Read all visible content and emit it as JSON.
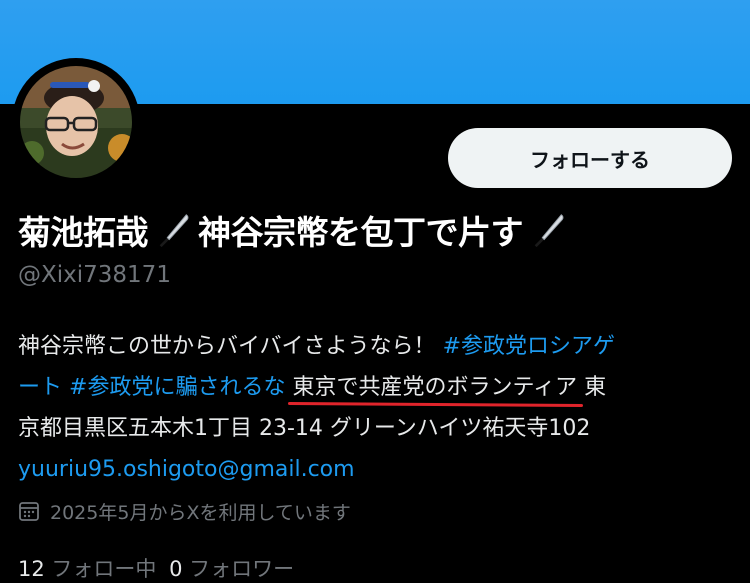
{
  "profile": {
    "name": "菊池拓哉",
    "name_middle": "神谷宗幣を包丁で片す",
    "knife_icon": "kitchen-knife-emoji",
    "handle": "@Xixi738171",
    "follow_label": "フォローする"
  },
  "bio": {
    "line1_text": "神谷宗幣この世からバイバイさようなら！",
    "hashtag1_part1": "#参政党ロシアゲ",
    "hashtag1_part2": "ート",
    "hashtag2": "#参政党に騙されるな",
    "underlined_text": "東京で共産党のボランティア",
    "line2_tail": "東",
    "line3_text": "京都目黒区五本木1丁目 23-14 グリーンハイツ祐天寺102",
    "email": "yuuriu95.oshigoto@gmail.com"
  },
  "joined": {
    "icon": "calendar-icon",
    "text": "2025年5月からXを利用しています"
  },
  "counts": {
    "following_count": "12",
    "following_label": "フォロー中",
    "followers_count": "0",
    "followers_label": "フォロワー"
  },
  "colors": {
    "banner": "#1d9bf0",
    "link": "#1d9bf0",
    "annotation_underline": "#e0242b",
    "muted_text": "#71767b"
  }
}
